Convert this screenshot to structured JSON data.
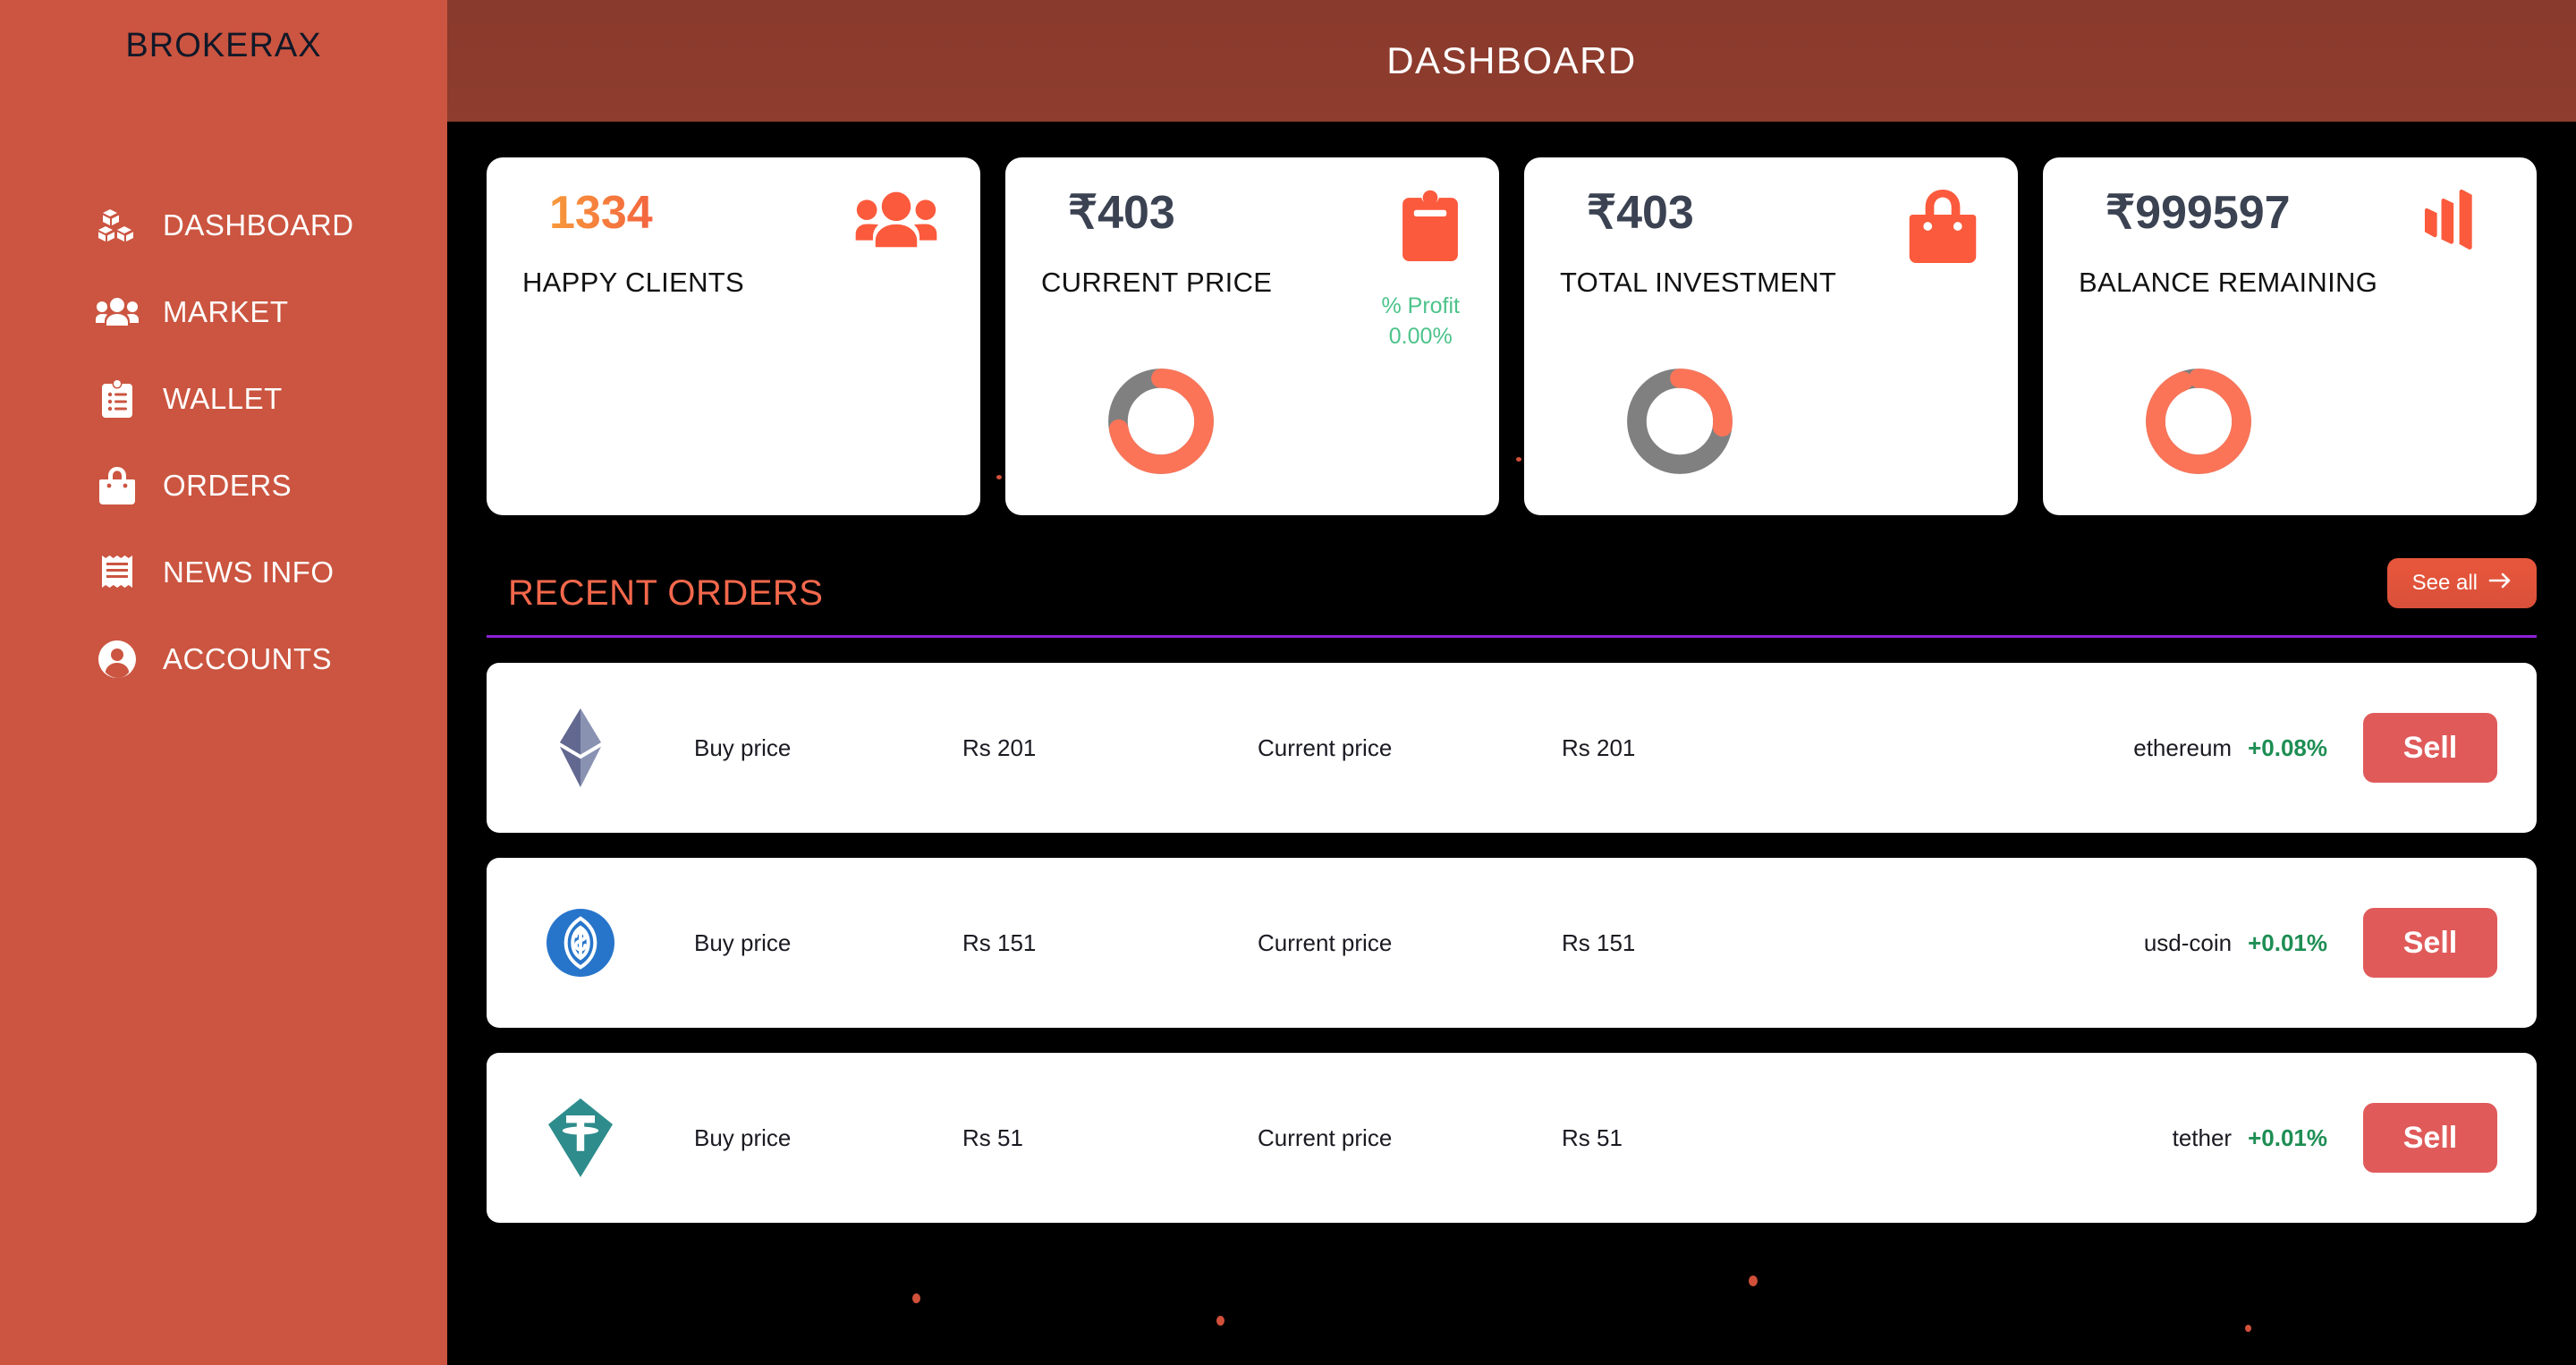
{
  "brand": {
    "name": "BROKERAX"
  },
  "header": {
    "title": "DASHBOARD"
  },
  "sidebar": {
    "items": [
      {
        "label": "DASHBOARD",
        "icon": "boxes-icon"
      },
      {
        "label": "MARKET",
        "icon": "people-group-icon"
      },
      {
        "label": "WALLET",
        "icon": "clipboard-list-icon"
      },
      {
        "label": "ORDERS",
        "icon": "shopping-bag-icon"
      },
      {
        "label": "NEWS INFO",
        "icon": "receipt-icon"
      },
      {
        "label": "ACCOUNTS",
        "icon": "user-circle-icon"
      }
    ]
  },
  "cards": [
    {
      "value": "1334",
      "label": "HAPPY CLIENTS",
      "icon": "people-group-icon",
      "gradient": true,
      "donut": null,
      "profit_label": null,
      "profit_value": null
    },
    {
      "value": "₹403",
      "label": "CURRENT PRICE",
      "icon": "clipboard-icon",
      "gradient": false,
      "donut": 72,
      "profit_label": "% Profit",
      "profit_value": "0.00%"
    },
    {
      "value": "₹403",
      "label": "TOTAL INVESTMENT",
      "icon": "shopping-bag-icon",
      "gradient": false,
      "donut": 27,
      "profit_label": null,
      "profit_value": null
    },
    {
      "value": "₹999597",
      "label": "BALANCE REMAINING",
      "icon": "bars-logo-icon",
      "gradient": false,
      "donut": 94,
      "profit_label": null,
      "profit_value": null
    }
  ],
  "recent_orders": {
    "title": "RECENT ORDERS",
    "see_all_label": "See all",
    "see_all_icon": "arrow-right-icon",
    "rows": [
      {
        "coin_icon": "ethereum-icon",
        "buy_label": "Buy price",
        "buy_value": "Rs 201",
        "current_label": "Current price",
        "current_value": "Rs 201",
        "name": "ethereum",
        "change": "+0.08%",
        "action_label": "Sell"
      },
      {
        "coin_icon": "usd-coin-icon",
        "buy_label": "Buy price",
        "buy_value": "Rs 151",
        "current_label": "Current price",
        "current_value": "Rs 151",
        "name": "usd-coin",
        "change": "+0.01%",
        "action_label": "Sell"
      },
      {
        "coin_icon": "tether-icon",
        "buy_label": "Buy price",
        "buy_value": "Rs 51",
        "current_label": "Current price",
        "current_value": "Rs 51",
        "name": "tether",
        "change": "+0.01%",
        "action_label": "Sell"
      }
    ]
  },
  "colors": {
    "sidebar": "#CB5540",
    "header": "#8C3B2D",
    "accent": "#FB5A3C",
    "background": "#000000",
    "divider": "#8B22D6",
    "positive": "#1E8E54",
    "sell": "#E05A5A",
    "donut_track": "#808080"
  }
}
